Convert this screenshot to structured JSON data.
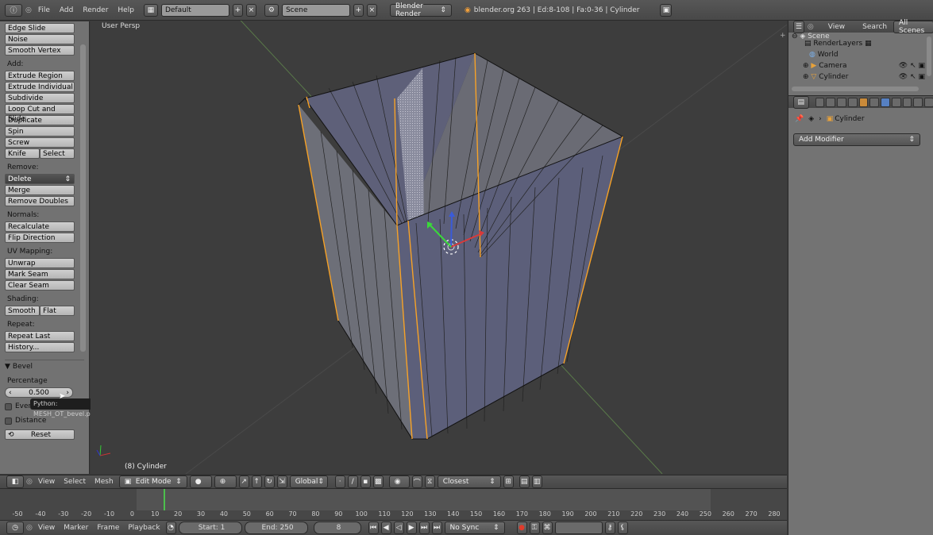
{
  "topbar": {
    "menus": [
      "File",
      "Add",
      "Render",
      "Help"
    ],
    "screen_layout": "Default",
    "scene": "Scene",
    "render_engine": "Blender Render",
    "status": "blender.org 263 | Ed:8-108 | Fa:0-36 | Cylinder"
  },
  "tools": {
    "deform_buttons": [
      "Edge Slide",
      "Noise",
      "Smooth Vertex"
    ],
    "add_label": "Add:",
    "add_buttons": [
      "Extrude Region",
      "Extrude Individual",
      "Subdivide",
      "Loop Cut and Slide",
      "Duplicate",
      "Spin",
      "Screw"
    ],
    "knife": "Knife",
    "select": "Select",
    "remove_label": "Remove:",
    "delete": "Delete",
    "merge": "Merge",
    "remove_doubles": "Remove Doubles",
    "normals_label": "Normals:",
    "recalculate": "Recalculate",
    "flip_direction": "Flip Direction",
    "uv_label": "UV Mapping:",
    "unwrap": "Unwrap",
    "mark_seam": "Mark Seam",
    "clear_seam": "Clear Seam",
    "shading_label": "Shading:",
    "smooth": "Smooth",
    "flat": "Flat",
    "repeat_label": "Repeat:",
    "repeat_last": "Repeat Last",
    "history": "History...",
    "bevel_title": "Bevel",
    "percentage_label": "Percentage",
    "percentage_value": "0.500",
    "even_label": "Even",
    "distance_label": "Distance",
    "reset": "Reset",
    "tooltip": "Python: MESH_OT_bevel.percent"
  },
  "viewport": {
    "view_label": "User Persp",
    "object_label": "(8) Cylinder"
  },
  "viewport_header": {
    "menus": [
      "View",
      "Select",
      "Mesh"
    ],
    "mode": "Edit Mode",
    "orientation": "Global",
    "snap": "Closest"
  },
  "timeline": {
    "ticks": [
      "-50",
      "-40",
      "-30",
      "-20",
      "-10",
      "0",
      "10",
      "20",
      "30",
      "40",
      "50",
      "60",
      "70",
      "80",
      "90",
      "100",
      "110",
      "120",
      "130",
      "140",
      "150",
      "160",
      "170",
      "180",
      "190",
      "200",
      "210",
      "220",
      "230",
      "240",
      "250",
      "260",
      "270",
      "280"
    ],
    "current_frame_fraction": 0.246,
    "menus": [
      "View",
      "Marker",
      "Frame",
      "Playback"
    ],
    "start": "Start: 1",
    "end": "End: 250",
    "frame": "8",
    "sync": "No Sync"
  },
  "outliner": {
    "menus": [
      "View",
      "Search"
    ],
    "filter": "All Scenes",
    "items": [
      {
        "label": "Scene"
      },
      {
        "label": "RenderLayers"
      },
      {
        "label": "World"
      },
      {
        "label": "Camera"
      },
      {
        "label": "Cylinder"
      }
    ]
  },
  "properties": {
    "object_name": "Cylinder",
    "add_modifier": "Add Modifier"
  },
  "colors": {
    "selected_edge": "#f7a227",
    "face_fill": "#5c5f7a",
    "accent": "#5680c2"
  }
}
